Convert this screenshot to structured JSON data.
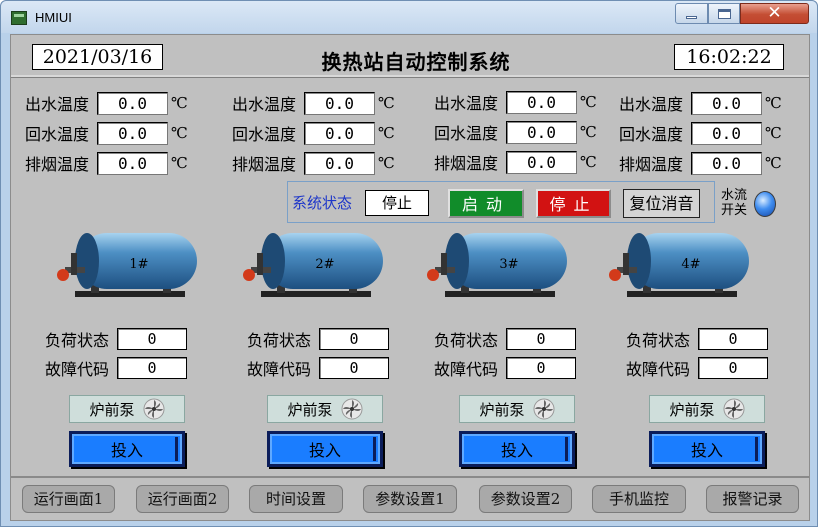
{
  "window": {
    "title": "HMIUI"
  },
  "header": {
    "date": "2021/03/16",
    "title": "换热站自动控制系统",
    "time": "16:02:22"
  },
  "temps": [
    {
      "rows": [
        {
          "label": "出水温度",
          "value": "0.0",
          "unit": "℃"
        },
        {
          "label": "回水温度",
          "value": "0.0",
          "unit": "℃"
        },
        {
          "label": "排烟温度",
          "value": "0.0",
          "unit": "℃"
        }
      ]
    },
    {
      "rows": [
        {
          "label": "出水温度",
          "value": "0.0",
          "unit": "℃"
        },
        {
          "label": "回水温度",
          "value": "0.0",
          "unit": "℃"
        },
        {
          "label": "排烟温度",
          "value": "0.0",
          "unit": "℃"
        }
      ]
    },
    {
      "rows": [
        {
          "label": "出水温度",
          "value": "0.0",
          "unit": "℃"
        },
        {
          "label": "回水温度",
          "value": "0.0",
          "unit": "℃"
        },
        {
          "label": "排烟温度",
          "value": "0.0",
          "unit": "℃"
        }
      ]
    },
    {
      "rows": [
        {
          "label": "出水温度",
          "value": "0.0",
          "unit": "℃"
        },
        {
          "label": "回水温度",
          "value": "0.0",
          "unit": "℃"
        },
        {
          "label": "排烟温度",
          "value": "0.0",
          "unit": "℃"
        }
      ]
    }
  ],
  "system": {
    "status_label": "系统状态",
    "status_value": "停止",
    "start_label": "启动",
    "stop_label": "停止",
    "reset_label": "复位消音",
    "flow_label": "水流开关",
    "flow_lamp_color": "#3f8df0"
  },
  "units": [
    {
      "boiler_label": "1#",
      "load_label": "负荷状态",
      "load_value": "0",
      "fault_label": "故障代码",
      "fault_value": "0",
      "pump_label": "炉前泵",
      "engage_label": "投入"
    },
    {
      "boiler_label": "2#",
      "load_label": "负荷状态",
      "load_value": "0",
      "fault_label": "故障代码",
      "fault_value": "0",
      "pump_label": "炉前泵",
      "engage_label": "投入"
    },
    {
      "boiler_label": "3#",
      "load_label": "负荷状态",
      "load_value": "0",
      "fault_label": "故障代码",
      "fault_value": "0",
      "pump_label": "炉前泵",
      "engage_label": "投入"
    },
    {
      "boiler_label": "4#",
      "load_label": "负荷状态",
      "load_value": "0",
      "fault_label": "故障代码",
      "fault_value": "0",
      "pump_label": "炉前泵",
      "engage_label": "投入"
    }
  ],
  "nav": [
    "运行画面1",
    "运行画面2",
    "时间设置",
    "参数设置1",
    "参数设置2",
    "手机监控",
    "报警记录"
  ],
  "colors": {
    "background": "#c0c0c0",
    "start": "#118c2a",
    "stop": "#d21212",
    "engage": "#1a7dff",
    "boiler": "#3f7fb5"
  }
}
